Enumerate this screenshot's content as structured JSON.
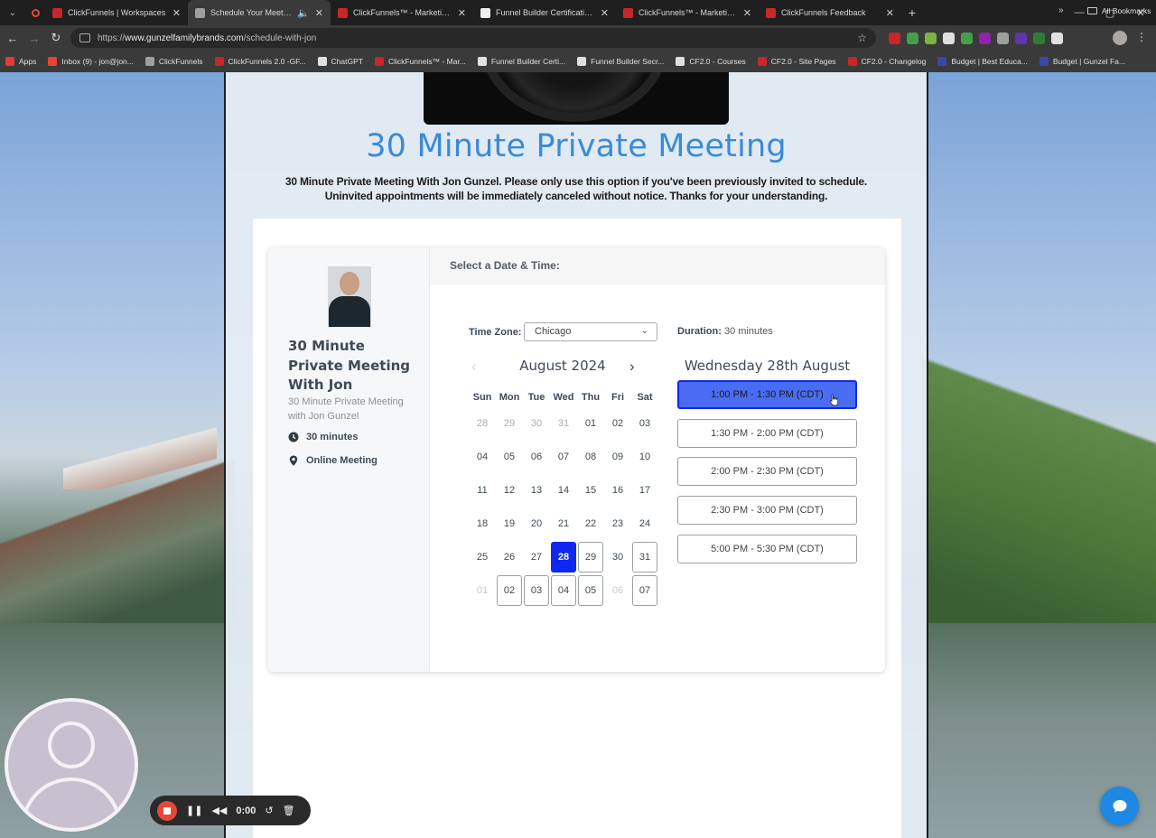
{
  "browser": {
    "tabs": [
      {
        "title": "ClickFunnels | Workspaces",
        "favicon_color": "#c62828"
      },
      {
        "title": "Schedule Your Meeting With",
        "favicon_color": "#9e9e9e",
        "active": true
      },
      {
        "title": "ClickFunnels™ - Marketing Fun",
        "favicon_color": "#c62828"
      },
      {
        "title": "Funnel Builder Certification | Fu",
        "favicon_color": "#eeeeee"
      },
      {
        "title": "ClickFunnels™ - Marketing Fun",
        "favicon_color": "#c62828"
      },
      {
        "title": "ClickFunnels Feedback",
        "favicon_color": "#c62828"
      }
    ],
    "url_scheme": "https://",
    "url_host": "www.gunzelfamilybrands.com",
    "url_path": "/schedule-with-jon",
    "bookmarks": [
      {
        "label": "Apps",
        "color": "#e53935"
      },
      {
        "label": "Inbox (9) - jon@jon...",
        "color": "#ea4335"
      },
      {
        "label": "ClickFunnels",
        "color": "#9e9e9e"
      },
      {
        "label": "ClickFunnels 2.0 -GF...",
        "color": "#c62828"
      },
      {
        "label": "ChatGPT",
        "color": "#e0e0e0"
      },
      {
        "label": "ClickFunnels™ - Mar...",
        "color": "#c62828"
      },
      {
        "label": "Funnel Builder Certi...",
        "color": "#e0e0e0"
      },
      {
        "label": "Funnel Builder Secr...",
        "color": "#e0e0e0"
      },
      {
        "label": "CF2.0 - Courses",
        "color": "#e0e0e0"
      },
      {
        "label": "CF2.0 - Site Pages",
        "color": "#c62828"
      },
      {
        "label": "CF2.0 - Changelog",
        "color": "#c62828"
      },
      {
        "label": "Budget | Best Educa...",
        "color": "#3949ab"
      },
      {
        "label": "Budget | Gunzel Fa...",
        "color": "#3949ab"
      }
    ],
    "bookmarks_more": "»",
    "all_bookmarks": "All Bookmarks",
    "extension_colors": [
      "#c62828",
      "#43a047",
      "#7cb342",
      "#e0e0e0",
      "#43a047",
      "#8e24aa",
      "#9e9e9e",
      "#5e35b1",
      "#2e7d32",
      "#e0e0e0"
    ]
  },
  "page": {
    "headline": "30 Minute Private Meeting",
    "subtext": "30 Minute Private Meeting With Jon Gunzel. Please only use this option if you've been previously invited to schedule. Uninvited appointments will be immediately canceled without notice. Thanks for your understanding.",
    "accent_color": "#3a8bd6"
  },
  "booking": {
    "event_title": "30 Minute Private Meeting With Jon",
    "event_description": "30 Minute Private Meeting with Jon Gunzel",
    "duration_meta": "30 minutes",
    "location_meta": "Online Meeting",
    "select_header": "Select a Date & Time:",
    "timezone_label": "Time Zone:",
    "timezone_value": "Chicago",
    "duration_label": "Duration:",
    "duration_value": "30 minutes",
    "calendar": {
      "month_title": "August 2024",
      "weekdays": [
        "Sun",
        "Mon",
        "Tue",
        "Wed",
        "Thu",
        "Fri",
        "Sat"
      ],
      "weeks": [
        [
          {
            "d": "28",
            "s": "other"
          },
          {
            "d": "29",
            "s": "other"
          },
          {
            "d": "30",
            "s": "other"
          },
          {
            "d": "31",
            "s": "other"
          },
          {
            "d": "01",
            "s": ""
          },
          {
            "d": "02",
            "s": ""
          },
          {
            "d": "03",
            "s": ""
          }
        ],
        [
          {
            "d": "04",
            "s": ""
          },
          {
            "d": "05",
            "s": ""
          },
          {
            "d": "06",
            "s": ""
          },
          {
            "d": "07",
            "s": ""
          },
          {
            "d": "08",
            "s": ""
          },
          {
            "d": "09",
            "s": ""
          },
          {
            "d": "10",
            "s": ""
          }
        ],
        [
          {
            "d": "11",
            "s": ""
          },
          {
            "d": "12",
            "s": ""
          },
          {
            "d": "13",
            "s": ""
          },
          {
            "d": "14",
            "s": ""
          },
          {
            "d": "15",
            "s": ""
          },
          {
            "d": "16",
            "s": ""
          },
          {
            "d": "17",
            "s": ""
          }
        ],
        [
          {
            "d": "18",
            "s": ""
          },
          {
            "d": "19",
            "s": ""
          },
          {
            "d": "20",
            "s": ""
          },
          {
            "d": "21",
            "s": ""
          },
          {
            "d": "22",
            "s": ""
          },
          {
            "d": "23",
            "s": ""
          },
          {
            "d": "24",
            "s": ""
          }
        ],
        [
          {
            "d": "25",
            "s": ""
          },
          {
            "d": "26",
            "s": ""
          },
          {
            "d": "27",
            "s": ""
          },
          {
            "d": "28",
            "s": "selected"
          },
          {
            "d": "29",
            "s": "avail"
          },
          {
            "d": "30",
            "s": ""
          },
          {
            "d": "31",
            "s": "avail"
          }
        ],
        [
          {
            "d": "01",
            "s": "faded"
          },
          {
            "d": "02",
            "s": "avail"
          },
          {
            "d": "03",
            "s": "avail"
          },
          {
            "d": "04",
            "s": "avail"
          },
          {
            "d": "05",
            "s": "avail"
          },
          {
            "d": "06",
            "s": "faded"
          },
          {
            "d": "07",
            "s": "avail"
          }
        ]
      ]
    },
    "selected_date_label": "Wednesday 28th August",
    "time_slots": [
      {
        "label": "1:00 PM - 1:30 PM (CDT)",
        "selected": true
      },
      {
        "label": "1:30 PM - 2:00 PM (CDT)",
        "selected": false
      },
      {
        "label": "2:00 PM - 2:30 PM (CDT)",
        "selected": false
      },
      {
        "label": "2:30 PM - 3:00 PM (CDT)",
        "selected": false
      },
      {
        "label": "5:00 PM - 5:30 PM (CDT)",
        "selected": false
      }
    ],
    "selected_color": "#0f28f0",
    "slot_selected_color": "#4a6cf2"
  },
  "recorder": {
    "time": "0:00",
    "stop_color": "#e5483a"
  },
  "chat": {
    "color": "#1e88e5"
  }
}
